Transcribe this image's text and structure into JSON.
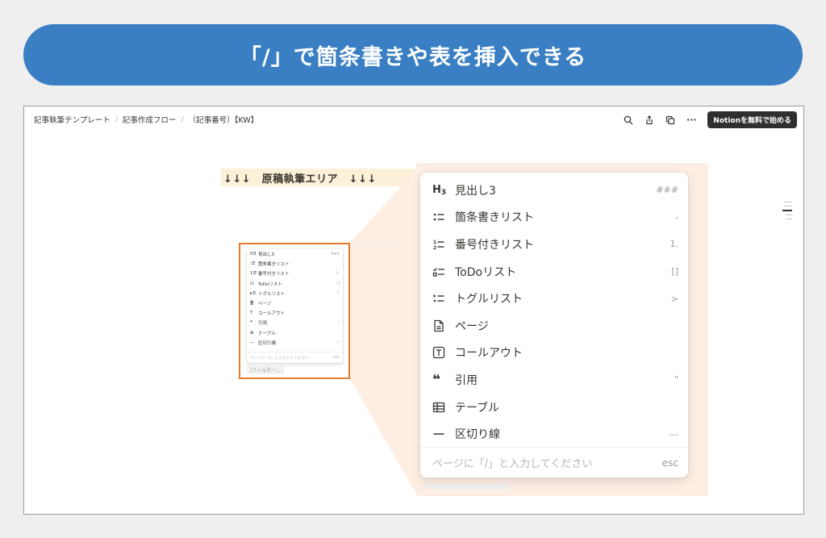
{
  "banner": {
    "title": "「/」で箇条書きや表を挿入できる"
  },
  "breadcrumbs": [
    "記事執筆テンプレート",
    "記事作成フロー",
    "（記事番号）【KW】"
  ],
  "top_actions": {
    "icons": [
      "search-icon",
      "share-icon",
      "duplicate-icon",
      "more-icon"
    ],
    "more_label": "···",
    "cta_label": "Notionを無料で始める"
  },
  "heading": "↓↓↓　原稿執筆エリア　↓↓↓",
  "menu": {
    "items": [
      {
        "icon": "heading3-icon",
        "glyph": "H3",
        "label": "見出し3",
        "shortcut": "###"
      },
      {
        "icon": "bulleted-list-icon",
        "glyph": "⁝☰",
        "label": "箇条書きリスト",
        "shortcut": "-"
      },
      {
        "icon": "numbered-list-icon",
        "glyph": "1☰",
        "label": "番号付きリスト",
        "shortcut": "1."
      },
      {
        "icon": "todo-list-icon",
        "glyph": "☑",
        "label": "ToDoリスト",
        "shortcut": "[]"
      },
      {
        "icon": "toggle-list-icon",
        "glyph": "▸☰",
        "label": "トグルリスト",
        "shortcut": ">"
      },
      {
        "icon": "page-icon",
        "glyph": "🗎",
        "label": "ページ",
        "shortcut": ""
      },
      {
        "icon": "callout-icon",
        "glyph": "T",
        "label": "コールアウト",
        "shortcut": ""
      },
      {
        "icon": "quote-icon",
        "glyph": "❝",
        "label": "引用",
        "shortcut": "\""
      },
      {
        "icon": "table-icon",
        "glyph": "⊞",
        "label": "テーブル",
        "shortcut": ""
      },
      {
        "icon": "divider-icon",
        "glyph": "—",
        "label": "区切り線",
        "shortcut": "---"
      }
    ],
    "hint": "ページに「/」と入力してください",
    "esc_label": "esc"
  },
  "filter_placeholder": "/フィルター...",
  "colors": {
    "banner": "#3a7fc4",
    "highlight_frame": "#e87a2a",
    "heading_bg": "#fbf1d9",
    "peach": "#fdeee4"
  }
}
